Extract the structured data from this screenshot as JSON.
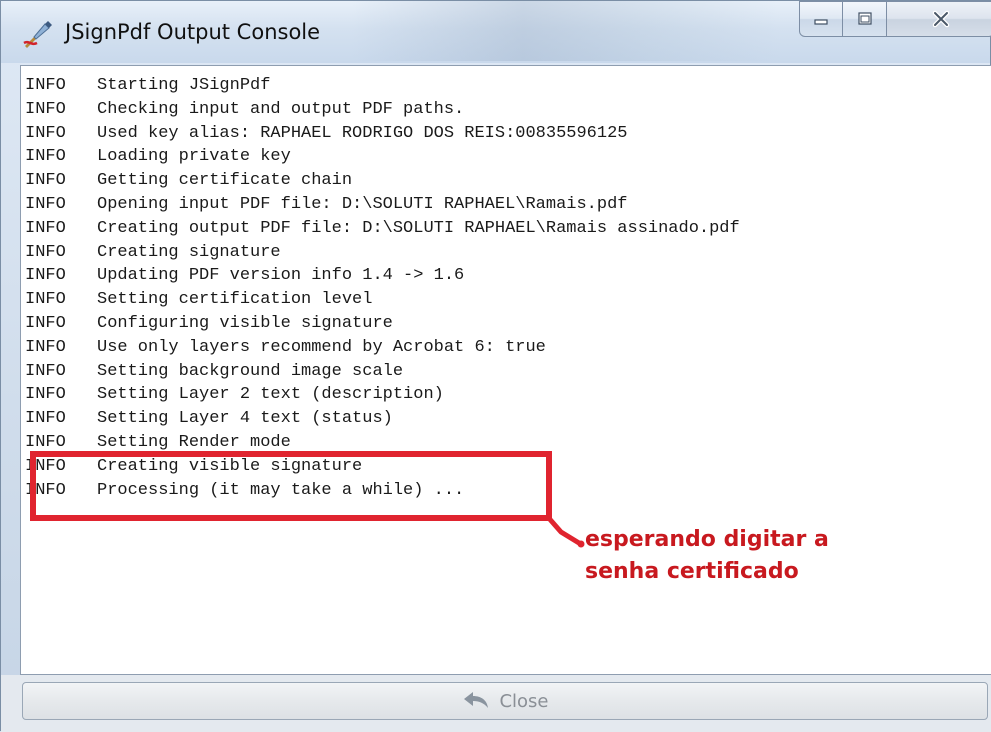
{
  "window": {
    "title": "JSignPdf Output Console"
  },
  "caption_buttons": {
    "minimize_icon": "minimize-icon",
    "maximize_icon": "maximize-icon",
    "close_icon": "close-x-icon"
  },
  "console": {
    "lines": [
      {
        "level": "INFO",
        "message": "Starting JSignPdf"
      },
      {
        "level": "INFO",
        "message": "Checking input and output PDF paths."
      },
      {
        "level": "INFO",
        "message": "Used key alias: RAPHAEL RODRIGO DOS REIS:00835596125"
      },
      {
        "level": "INFO",
        "message": "Loading private key"
      },
      {
        "level": "INFO",
        "message": "Getting certificate chain"
      },
      {
        "level": "INFO",
        "message": "Opening input PDF file: D:\\SOLUTI RAPHAEL\\Ramais.pdf"
      },
      {
        "level": "INFO",
        "message": "Creating output PDF file: D:\\SOLUTI RAPHAEL\\Ramais assinado.pdf"
      },
      {
        "level": "INFO",
        "message": "Creating signature"
      },
      {
        "level": "INFO",
        "message": "Updating PDF version info 1.4 -> 1.6"
      },
      {
        "level": "INFO",
        "message": "Setting certification level"
      },
      {
        "level": "INFO",
        "message": "Configuring visible signature"
      },
      {
        "level": "INFO",
        "message": "Use only layers recommend by Acrobat 6: true"
      },
      {
        "level": "INFO",
        "message": "Setting background image scale"
      },
      {
        "level": "INFO",
        "message": "Setting Layer 2 text (description)"
      },
      {
        "level": "INFO",
        "message": "Setting Layer 4 text (status)"
      },
      {
        "level": "INFO",
        "message": "Setting Render mode"
      },
      {
        "level": "INFO",
        "message": "Creating visible signature"
      },
      {
        "level": "INFO",
        "message": "Processing (it may take a while) ..."
      }
    ]
  },
  "annotation": {
    "text": "esperando digitar a\nsenha certificado",
    "color": "#c8191f"
  },
  "footer": {
    "close_label": "Close",
    "close_icon": "undo-arrow-icon"
  }
}
